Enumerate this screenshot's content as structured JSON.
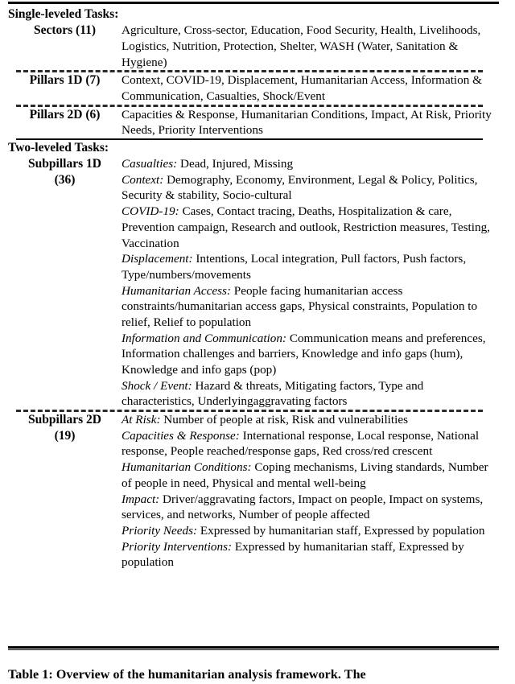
{
  "table": {
    "sections": [
      {
        "heading": "Single-leveled Tasks:",
        "rows": [
          {
            "label_line1": "Sectors (11)",
            "label_line2": "",
            "entries": [
              {
                "key": "",
                "value": "Agriculture, Cross-sector, Education, Food Security, Health, Livelihoods, Logistics, Nutrition, Protection, Shelter, WASH (Water, Sanitation & Hygiene)"
              }
            ]
          },
          {
            "label_line1": "Pillars 1D (7)",
            "label_line2": "",
            "entries": [
              {
                "key": "",
                "value": "Context, COVID-19, Displacement, Humanitarian Access, Information & Communication, Casualties, Shock/Event"
              }
            ]
          },
          {
            "label_line1": "Pillars 2D (6)",
            "label_line2": "",
            "entries": [
              {
                "key": "",
                "value": "Capacities & Response, Humanitarian Conditions, Impact, At Risk, Priority Needs, Priority Interventions"
              }
            ]
          }
        ]
      },
      {
        "heading": "Two-leveled Tasks:",
        "rows": [
          {
            "label_line1": "Subpillars 1D",
            "label_line2": "(36)",
            "entries": [
              {
                "key": "Casualties:",
                "value": "Dead, Injured, Missing"
              },
              {
                "key": "Context:",
                "value": "Demography, Economy, Environment, Legal & Policy, Politics, Security & stability, Socio-cultural"
              },
              {
                "key": "COVID-19:",
                "value": "Cases, Contact tracing, Deaths, Hospitalization & care, Prevention campaign, Research and outlook, Restriction measures, Testing, Vaccination"
              },
              {
                "key": "Displacement:",
                "value": "Intentions, Local integration, Pull factors, Push factors, Type/numbers/movements"
              },
              {
                "key": "Humanitarian Access:",
                "value": "People facing humanitarian access constraints/humanitarian access gaps, Physical constraints, Population to relief, Relief to population"
              },
              {
                "key": "Information and Communication:",
                "value": "Communication means and preferences, Information challenges and barriers, Knowledge and info gaps (hum), Knowledge and info gaps (pop)"
              },
              {
                "key": "Shock / Event:",
                "value": "Hazard & threats, Mitigating factors, Type and characteristics, Underlyingaggravating factors"
              }
            ]
          },
          {
            "label_line1": "Subpillars 2D",
            "label_line2": "(19)",
            "entries": [
              {
                "key": "At Risk:",
                "value": "Number of people at risk, Risk and vulnerabilities"
              },
              {
                "key": "Capacities & Response:",
                "value": "International response, Local response, National response, People reached/response gaps, Red cross/red crescent"
              },
              {
                "key": "Humanitarian Conditions:",
                "value": "Coping mechanisms, Living standards, Number of people in need, Physical and mental well-being"
              },
              {
                "key": "Impact:",
                "value": "Driver/aggravating factors, Impact on people, Impact on systems, services, and networks, Number of people affected"
              },
              {
                "key": "Priority Needs:",
                "value": "Expressed by humanitarian staff, Expressed by population"
              },
              {
                "key": "Priority Interventions:",
                "value": "Expressed by humanitarian staff, Expressed by population"
              }
            ]
          }
        ]
      }
    ]
  },
  "caption": {
    "text": "Table 1:  Overview of the humanitarian analysis framework. The"
  }
}
